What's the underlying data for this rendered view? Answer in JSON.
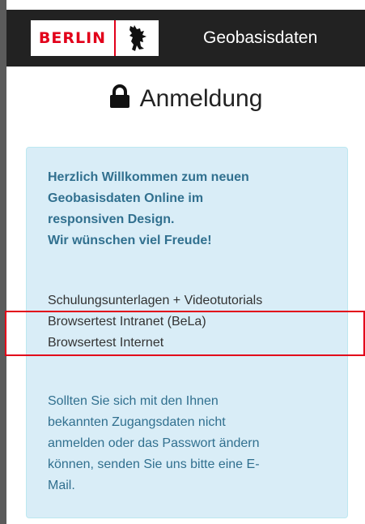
{
  "header": {
    "logo_text": "BERLIN",
    "app_title": "Geobasisdaten"
  },
  "login": {
    "title": "Anmeldung"
  },
  "info": {
    "welcome_lines": [
      "Herzlich Willkommen zum neuen",
      "Geobasisdaten Online im",
      "responsiven Design.",
      "Wir wünschen viel Freude!"
    ],
    "links": [
      "Schulungsunterlagen + Videotutorials",
      "Browsertest Intranet (BeLa)",
      "Browsertest Internet"
    ],
    "notice_lines": [
      "Sollten Sie sich mit den Ihnen",
      "bekannten Zugangsdaten nicht",
      "anmelden oder das Passwort ändern",
      "können, senden Sie uns bitte eine E-",
      "Mail."
    ]
  },
  "colors": {
    "header_bg": "#222222",
    "brand_red": "#e2001a",
    "panel_bg": "#d9edf7",
    "panel_text": "#31708f"
  },
  "icons": {
    "logo": "berlin-bear-icon",
    "login": "lock-icon"
  }
}
